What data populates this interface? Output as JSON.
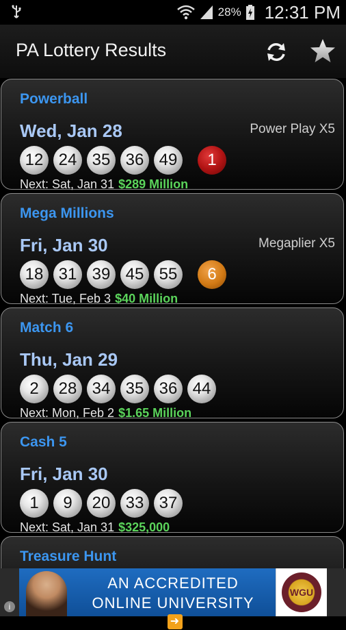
{
  "status_bar": {
    "battery": "28%",
    "time": "12:31 PM"
  },
  "action_bar": {
    "title": "PA Lottery Results"
  },
  "games": [
    {
      "name": "Powerball",
      "date": "Wed, Jan 28",
      "multiplier": "Power Play X5",
      "numbers": [
        "12",
        "24",
        "35",
        "36",
        "49"
      ],
      "bonus": "1",
      "next": "Next: Sat, Jan 31",
      "jackpot": "$289 Million"
    },
    {
      "name": "Mega Millions",
      "date": "Fri, Jan 30",
      "multiplier": "Megaplier X5",
      "numbers": [
        "18",
        "31",
        "39",
        "45",
        "55"
      ],
      "bonus": "6",
      "next": "Next: Tue, Feb 3",
      "jackpot": "$40 Million"
    },
    {
      "name": "Match 6",
      "date": "Thu, Jan 29",
      "numbers": [
        "2",
        "28",
        "34",
        "35",
        "36",
        "44"
      ],
      "next": "Next: Mon, Feb 2",
      "jackpot": "$1.65 Million"
    },
    {
      "name": "Cash 5",
      "date": "Fri, Jan 30",
      "numbers": [
        "1",
        "9",
        "20",
        "33",
        "37"
      ],
      "next": "Next: Sat, Jan 31",
      "jackpot": "$325,000"
    },
    {
      "name": "Treasure Hunt"
    }
  ],
  "ad": {
    "line1": "AN ACCREDITED",
    "line2": "ONLINE UNIVERSITY",
    "logo_text": "WGU"
  },
  "colors": {
    "game_name": "#3c96f0",
    "date": "#a9c8f5",
    "jackpot": "#5bd45b",
    "powerball": "#b21414",
    "megaball": "#d27a15"
  }
}
